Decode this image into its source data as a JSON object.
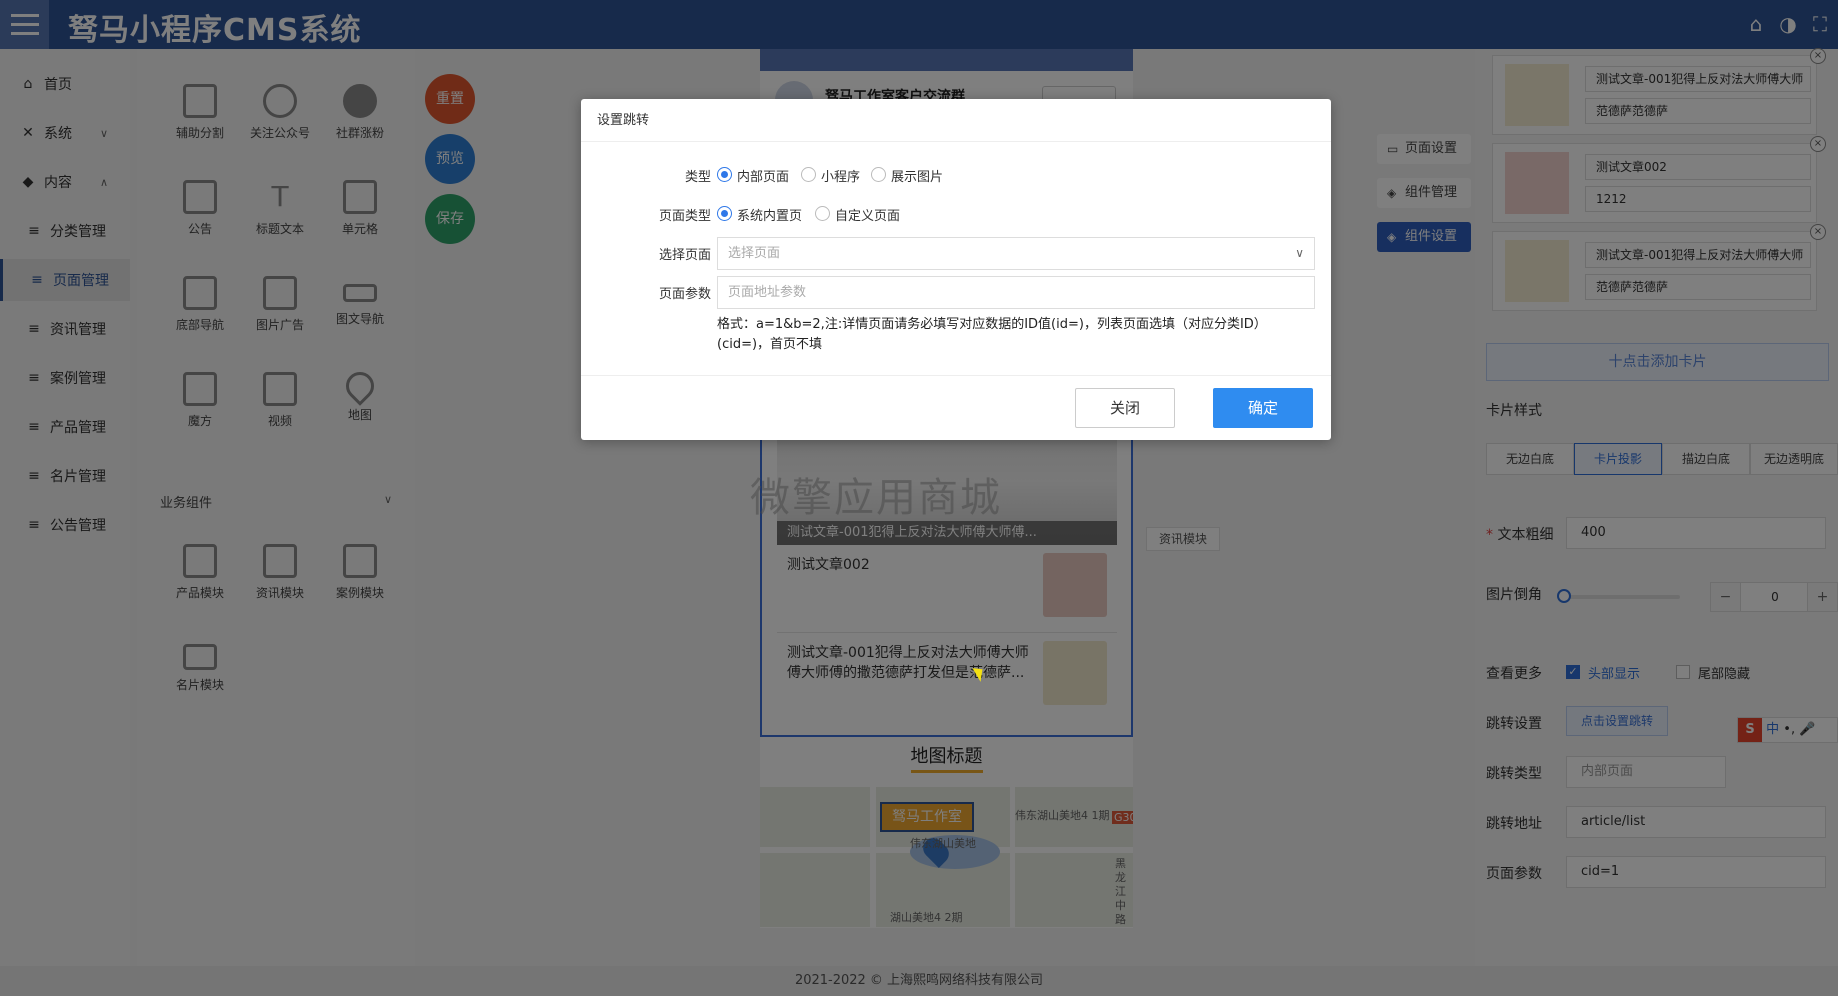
{
  "header": {
    "title": "驽马小程序CMS系统"
  },
  "sidebar": {
    "items": [
      {
        "label": "首页",
        "icon": "home-icon"
      },
      {
        "label": "系统",
        "icon": "tools-icon"
      },
      {
        "label": "内容",
        "icon": "cube-icon"
      },
      {
        "label": "分类管理",
        "icon": "list-icon"
      },
      {
        "label": "页面管理",
        "icon": "list-icon"
      },
      {
        "label": "资讯管理",
        "icon": "list-icon"
      },
      {
        "label": "案例管理",
        "icon": "list-icon"
      },
      {
        "label": "产品管理",
        "icon": "list-icon"
      },
      {
        "label": "名片管理",
        "icon": "list-icon"
      },
      {
        "label": "公告管理",
        "icon": "list-icon"
      }
    ]
  },
  "components": {
    "basic": [
      {
        "label": "辅助分割"
      },
      {
        "label": "关注公众号"
      },
      {
        "label": "社群涨粉"
      },
      {
        "label": "公告"
      },
      {
        "label": "标题文本"
      },
      {
        "label": "单元格"
      },
      {
        "label": "底部导航"
      },
      {
        "label": "图片广告"
      },
      {
        "label": "图文导航"
      },
      {
        "label": "魔方"
      },
      {
        "label": "视频"
      },
      {
        "label": "地图"
      }
    ],
    "business_title": "业务组件",
    "business": [
      {
        "label": "产品模块"
      },
      {
        "label": "资讯模块"
      },
      {
        "label": "案例模块"
      },
      {
        "label": "名片模块"
      }
    ]
  },
  "actions": {
    "reset": "重置",
    "preview": "预览",
    "save": "保存"
  },
  "preview": {
    "group_name": "驽马工作室客户交流群",
    "watermark": "微擎应用商城",
    "news_hero_caption": "测试文章-001犯得上反对法大师傅大师傅...",
    "news_items": [
      {
        "title": "测试文章002"
      },
      {
        "title": "测试文章-001犯得上反对法大师傅大师傅大师傅的撒范德萨打发但是范德萨..."
      }
    ],
    "news_module_label": "资讯模块",
    "map_title": "地图标题",
    "map_tag": "驽马工作室",
    "map_labels": [
      "伟东湖山美地4 1期",
      "湖山美地4 2期",
      "伟东湖山美地",
      "G30",
      "黑龙江中路"
    ]
  },
  "right_tabs": {
    "page_settings": "页面设置",
    "component_manage": "组件管理",
    "component_settings": "组件设置"
  },
  "cards": [
    {
      "title": "测试文章-001犯得上反对法大师傅大师",
      "subtitle": "范德萨范德萨"
    },
    {
      "title": "测试文章002",
      "subtitle": "1212"
    },
    {
      "title": "测试文章-001犯得上反对法大师傅大师",
      "subtitle": "范德萨范德萨"
    }
  ],
  "settings": {
    "add_card": "十点击添加卡片",
    "card_style_label": "卡片样式",
    "card_styles": [
      "无边白底",
      "卡片投影",
      "描边白底",
      "无边透明底"
    ],
    "text_weight_label": "文本粗细",
    "text_weight_value": "400",
    "image_radius_label": "图片倒角",
    "image_radius_value": "0",
    "view_more_label": "查看更多",
    "show_header": "头部显示",
    "hide_footer": "尾部隐藏",
    "jump_settings_label": "跳转设置",
    "jump_settings_button": "点击设置跳转",
    "jump_type_label": "跳转类型",
    "jump_type_value": "内部页面",
    "jump_url_label": "跳转地址",
    "jump_url_value": "article/list",
    "page_params_label": "页面参数",
    "page_params_value": "cid=1"
  },
  "ime": {
    "label": "中"
  },
  "footer": {
    "text": "2021-2022 © 上海熙鸣网络科技有限公司"
  },
  "modal": {
    "title": "设置跳转",
    "type_label": "类型",
    "type_options": [
      "内部页面",
      "小程序",
      "展示图片"
    ],
    "page_type_label": "页面类型",
    "page_type_options": [
      "系统内置页",
      "自定义页面"
    ],
    "select_page_label": "选择页面",
    "select_page_placeholder": "选择页面",
    "params_label": "页面参数",
    "params_placeholder": "页面地址参数",
    "hint": "格式：a=1&b=2,注:详情页面请务必填写对应数据的ID值(id=)，列表页面选填（对应分类ID）(cid=)，首页不填",
    "close": "关闭",
    "confirm": "确定"
  }
}
